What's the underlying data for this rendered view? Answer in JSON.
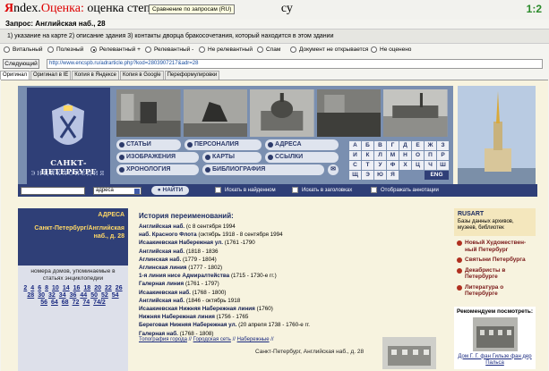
{
  "header": {
    "logo_y": "Я",
    "logo_ndex": "ndex.",
    "logo_oc": "Оценка:",
    "logo_rest": "оценка степени со",
    "logo_tail": "су",
    "tooltip": "Сравнение по запросам (RU)",
    "ratio": "1:2"
  },
  "query": {
    "label": "Запрос: Английская наб., 28"
  },
  "instructions": "1) указание на карте 2) описание здания 3) контакты дворца бракосочетания, который находится в этом здании",
  "ratings": [
    {
      "label": "Витальный",
      "selected": false
    },
    {
      "label": "Полезный",
      "selected": false
    },
    {
      "label": "Релевантный +",
      "selected": true
    },
    {
      "label": "Релевантный -",
      "selected": false
    },
    {
      "label": "Не релевантный",
      "selected": false
    },
    {
      "label": "Спам",
      "selected": false
    },
    {
      "label": "Документ не открывается",
      "selected": false
    },
    {
      "label": "Не оценено",
      "selected": false
    }
  ],
  "nav": {
    "next_label": "Следующий",
    "url": "http://www.encspb.ru/adrarticle.php?kod=2803907217&adr=28"
  },
  "tabs": [
    {
      "label": "Оригинал",
      "active": true
    },
    {
      "label": "Оригинал в IE",
      "active": false
    },
    {
      "label": "Копия в Яндексе",
      "active": false
    },
    {
      "label": "Копия в Google",
      "active": false
    },
    {
      "label": "Переформулировки",
      "active": false
    }
  ],
  "site": {
    "logo_title": "САНКТ-ПЕТЕРБУРГ",
    "logo_sub": "ЭНЦИКЛОПЕДИЯ",
    "menu": {
      "statyi": "СТАТЬИ",
      "personalia": "ПЕРСОНАЛИЯ",
      "adresa": "АДРЕСА",
      "izobrazheniya": "ИЗОБРАЖЕНИЯ",
      "karty": "КАРТЫ",
      "ssylki": "ССЫЛКИ",
      "hronologiya": "ХРОНОЛОГИЯ",
      "bibliografiya": "БИБЛИОГРАФИЯ"
    },
    "alphabet": [
      "А",
      "Б",
      "В",
      "Г",
      "Д",
      "Е",
      "Ж",
      "З",
      "И",
      "К",
      "Л",
      "М",
      "Н",
      "О",
      "П",
      "Р",
      "С",
      "Т",
      "У",
      "Ф",
      "Х",
      "Ц",
      "Ч",
      "Ш",
      "Щ",
      "Э",
      "Ю",
      "Я"
    ],
    "alphabet_eng": "ENG",
    "search": {
      "select_value": "адреса",
      "find_label": "НАЙТИ",
      "chk_found": "Искать в найденном",
      "chk_titles": "Искать в заголовках",
      "chk_annot": "Отображать аннотации"
    },
    "left": {
      "label": "АДРЕСА",
      "address": "Санкт-Петербург/Английская наб., д. 28",
      "note": "номера домов, упоминаемые в статьях энциклопедии",
      "pages": [
        "2",
        "4",
        "6",
        "8",
        "10",
        "14",
        "16",
        "18",
        "20",
        "22",
        "26",
        "28",
        "30",
        "32",
        "34",
        "36",
        "44",
        "50",
        "52",
        "54",
        "56",
        "64",
        "68",
        "72",
        "74",
        "74/2"
      ]
    },
    "main": {
      "title": "История переименований:",
      "history": [
        {
          "name": "Английская наб.",
          "period": "(с 8 сентября 1994"
        },
        {
          "name": "наб. Красного Флота",
          "period": "(октябрь 1918 - 8 сентября 1994"
        },
        {
          "name": "Исаакиевская Набережная ул.",
          "period": "(1761 -1790"
        },
        {
          "name": "Английская наб.",
          "period": "(1818 - 1836"
        },
        {
          "name": "Аглинская наб.",
          "period": "(1779 - 1804)"
        },
        {
          "name": "Аглинская линия",
          "period": "(1777 - 1802)"
        },
        {
          "name": "1-я линия нисе Адмиралтейства",
          "period": "(1715 - 1730-е гг.)"
        },
        {
          "name": "Галерная линия",
          "period": "(1761 - 1797)"
        },
        {
          "name": "Исаакиевская наб.",
          "period": "(1768 - 1800)"
        },
        {
          "name": "Английская наб.",
          "period": "(1846 - октябрь 1918"
        },
        {
          "name": "Исаакиевская Нижняя Набережная линия",
          "period": "(1760)"
        },
        {
          "name": "Нижняя Набережная линия",
          "period": "(1756 - 1765"
        },
        {
          "name": "Береговая Нижняя Набережная ул.",
          "period": "(20 апреля 1738 - 1760-е гг."
        },
        {
          "name": "Галерная наб.",
          "period": "(1768 - 1808)"
        }
      ],
      "crumbs": [
        "Топография города",
        "Городская сеть",
        "Набережные"
      ],
      "crumb_sep": "//",
      "doc_address": "Санкт-Петербург, Английская наб., д. 28"
    },
    "right": {
      "title": "RUSART",
      "desc": "Базы данных архивов, музеев, библиотек",
      "items": [
        "Новый Художествен-ный Петербург",
        "Святыни Петербурга",
        "Декабристы в Петербурге",
        "Литература о Петербурге"
      ],
      "recommend_title": "Рекомендуем посмотреть:",
      "recommend_caption": "Дом Г. Г. фан Гильзе фан дер Пальса"
    }
  }
}
